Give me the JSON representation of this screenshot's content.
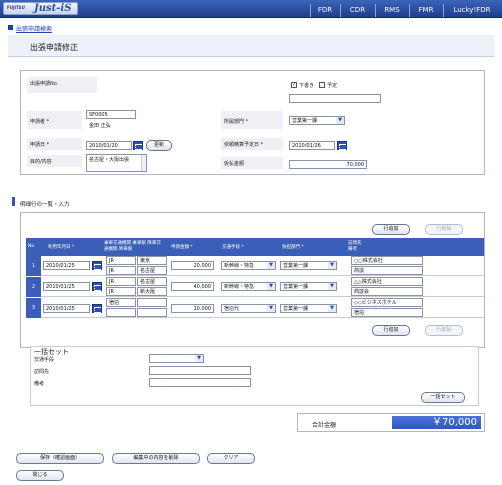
{
  "app": {
    "logo_small": "FUJITSU",
    "logo_main": "Just-iS",
    "nav": [
      "FDR",
      "CDR",
      "RMS",
      "FMR",
      "Lucky!FDR"
    ]
  },
  "breadcrumb": "出張申請検索",
  "page_title": "出張申請修正",
  "header_form": {
    "app_no_label": "出張申請No.",
    "draft_label": "下書き",
    "schedule_label": "予定",
    "applicant_label": "申請者 *",
    "applicant_code": "SF0005",
    "applicant_name": "金田 正弘",
    "dept_label": "所属部門 *",
    "dept_value": "営業第一課",
    "apply_date_label": "申請日 *",
    "apply_date": "2010/01/20",
    "update_button": "更新",
    "settle_date_label": "依頼精算予定日 *",
    "settle_date": "2010/01/26",
    "purpose_label": "目的/内容",
    "purpose_value": "名古屋・大阪出張",
    "advance_label": "仮払金額",
    "advance_value": "70,000"
  },
  "details": {
    "section_title": "明細行の一覧・入力",
    "add_row": "行追加",
    "delete_row": "行削除",
    "columns": {
      "no": "No.",
      "date": "利用年月日 *",
      "transport": "乗車交通機関 乗車駅 降車交通機関 降車駅",
      "amount": "申請金額 *",
      "subject": "交通手段 *",
      "dept": "負担部門 *",
      "visit": "訪問先 備考"
    },
    "rows": [
      {
        "no": "1",
        "date": "2010/01/25",
        "t1": "JR",
        "t2": "JR",
        "s1": "東京",
        "s2": "名古屋",
        "amount": "20,000",
        "subject": "新幹線・特急",
        "dept": "営業第一課",
        "visit": "○○株式会社",
        "note": "商談"
      },
      {
        "no": "2",
        "date": "2010/01/25",
        "t1": "JR",
        "t2": "JR",
        "s1": "名古屋",
        "s2": "新大阪",
        "amount": "40,000",
        "subject": "新幹線・特急",
        "dept": "営業第一課",
        "visit": "△△株式会社",
        "note": "商談会"
      },
      {
        "no": "3",
        "date": "2010/01/25",
        "t1": "宿泊",
        "t2": "",
        "s1": "",
        "s2": "",
        "amount": "10,000",
        "subject": "宿泊代",
        "dept": "営業第一課",
        "visit": "◇◇ビジネスホテル",
        "note": "宿泊"
      }
    ]
  },
  "bulk": {
    "title": "一括セット",
    "transport_label": "交通手段",
    "visit_label": "訪問先",
    "note_label": "備考",
    "set_button": "一括セット"
  },
  "total": {
    "label": "合計金額",
    "value": "￥70,000"
  },
  "footer": {
    "save": "保存（確認画面）",
    "delete_edit": "編集中の内容を削除",
    "clear": "クリア",
    "close": "閉じる"
  }
}
